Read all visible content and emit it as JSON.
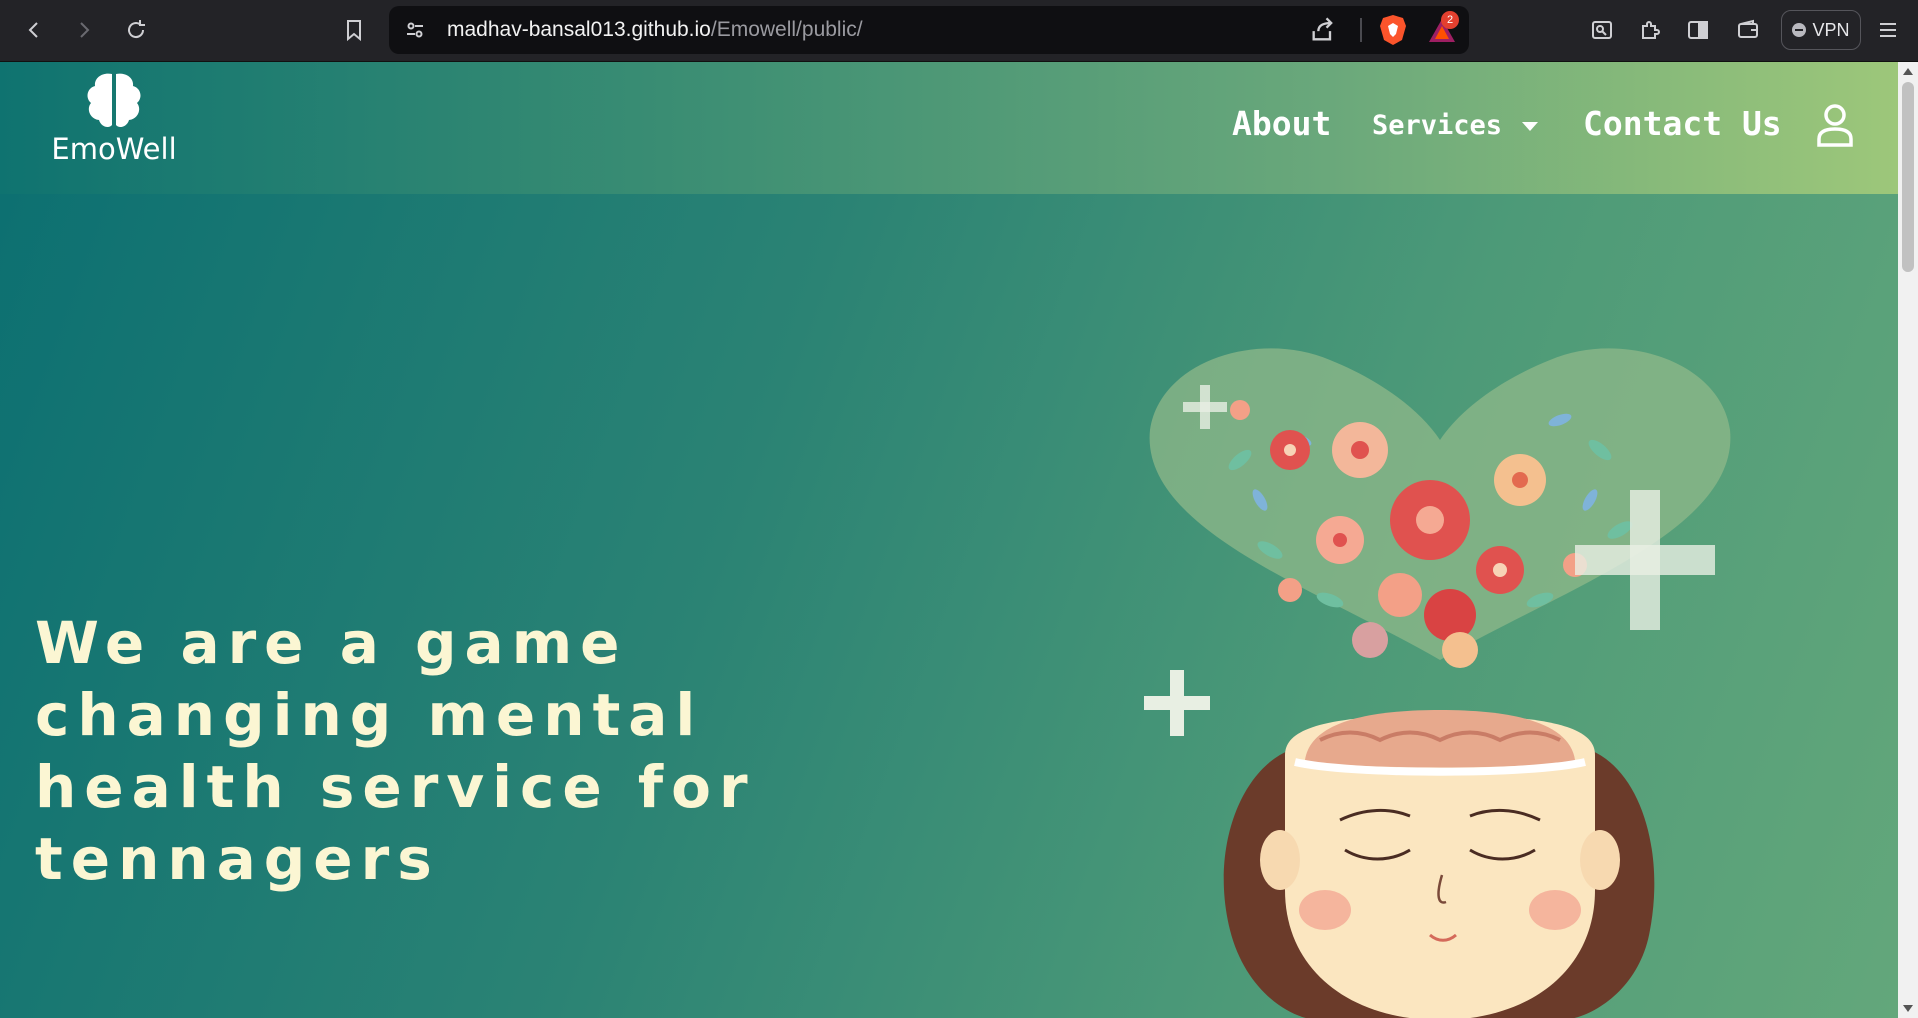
{
  "browser": {
    "url_host": "madhav-bansal013.github.io",
    "url_path": "/Emowell/public/",
    "rewards_badge": "2",
    "vpn_label": "VPN"
  },
  "site": {
    "logo_text": "EmoWell",
    "nav": {
      "about": "About",
      "services": "Services",
      "contact": "Contact Us"
    },
    "hero_title": "We are a game changing mental health service for tennagers"
  },
  "icons": [
    "back-icon",
    "forward-icon",
    "reload-icon",
    "bookmark-icon",
    "site-settings-icon",
    "share-icon",
    "brave-shields-icon",
    "brave-rewards-icon",
    "leo-ai-icon",
    "extensions-icon",
    "sidebar-icon",
    "wallet-icon",
    "menu-icon",
    "brain-logo-icon",
    "user-icon",
    "chevron-down-icon"
  ],
  "colors": {
    "hero_text": "#fbf6d3",
    "nav_gradient_start": "#0f7370",
    "nav_gradient_end": "#9dc77a",
    "hero_bg": "#2b8374"
  }
}
